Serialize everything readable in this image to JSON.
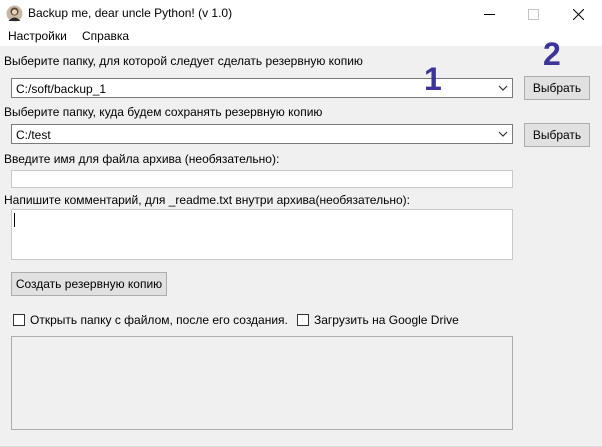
{
  "window": {
    "title": "Backup me, dear uncle Python! (v 1.0)",
    "icon": "python-avatar-icon",
    "controls": [
      "minimize-icon",
      "maximize-icon",
      "close-icon"
    ]
  },
  "menu": {
    "items": [
      "Настройки",
      "Справка"
    ]
  },
  "form": {
    "source_label": "Выберите папку, для которой следует сделать резервную копию",
    "source_value": "C:/soft/backup_1",
    "source_button": "Выбрать",
    "dest_label": "Выберите папку, куда будем сохранять резервную копию",
    "dest_value": "C:/test",
    "dest_button": "Выбрать",
    "archive_name_label": "Введите имя для файла архива (необязательно):",
    "archive_name_value": "",
    "comment_label": "Напишите комментарий, для _readme.txt внутри архива(необязательно):",
    "comment_value": "",
    "create_button": "Создать резервную копию",
    "open_folder_checkbox": "Открыть папку с файлом, после его создания.",
    "open_folder_checked": false,
    "gdrive_checkbox": "Загрузить на Google Drive",
    "gdrive_checked": false
  },
  "annotations": {
    "marker_1": "1",
    "marker_2": "2",
    "color": "#3d3499"
  }
}
